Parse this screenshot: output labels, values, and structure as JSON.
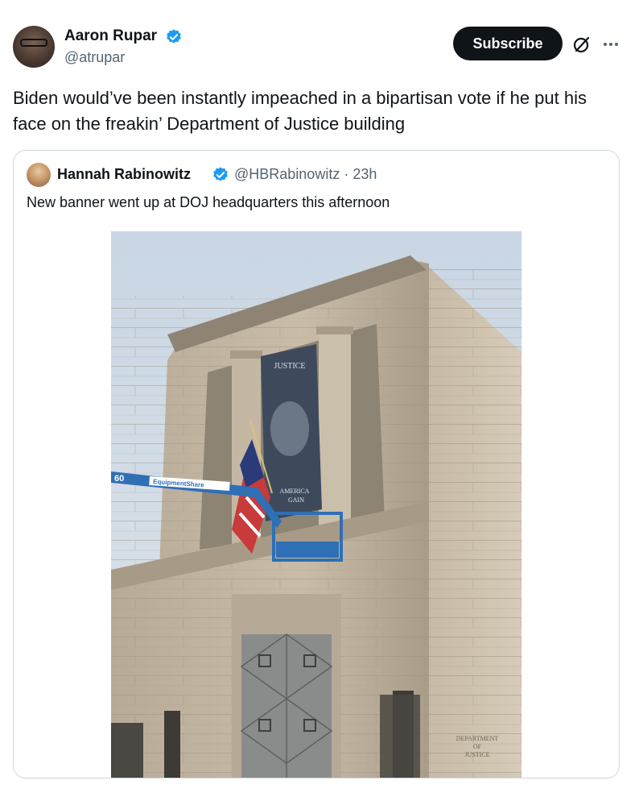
{
  "tweet": {
    "author_name": "Aaron Rupar",
    "author_handle": "@atrupar",
    "subscribe_label": "Subscribe",
    "text": "Biden would’ve been instantly  impeached in a bipartisan vote if he put his face on the freakin’ Department of Justice building"
  },
  "quoted": {
    "author_name": "Hannah Rabinowitz",
    "author_handle": "@HBRabinowitz · 23h",
    "text": "New banner went up at DOJ headquarters this afternoon",
    "photo": {
      "banner_top": "JUSTICE",
      "banner_bottom_1": "AMERICA",
      "banner_bottom_2": "GAIN",
      "lift_number": "60",
      "lift_brand": "EquipmentShare",
      "engraving_1": "DEPARTMENT",
      "engraving_2": "OF",
      "engraving_3": "JUSTICE"
    }
  },
  "icons": [
    "verified-badge-icon",
    "grok-icon",
    "more-icon"
  ],
  "colors": {
    "verified": "#1d9bf0",
    "subscribe_bg": "#0f1419",
    "handle": "#536471",
    "border": "#cfd9de"
  }
}
